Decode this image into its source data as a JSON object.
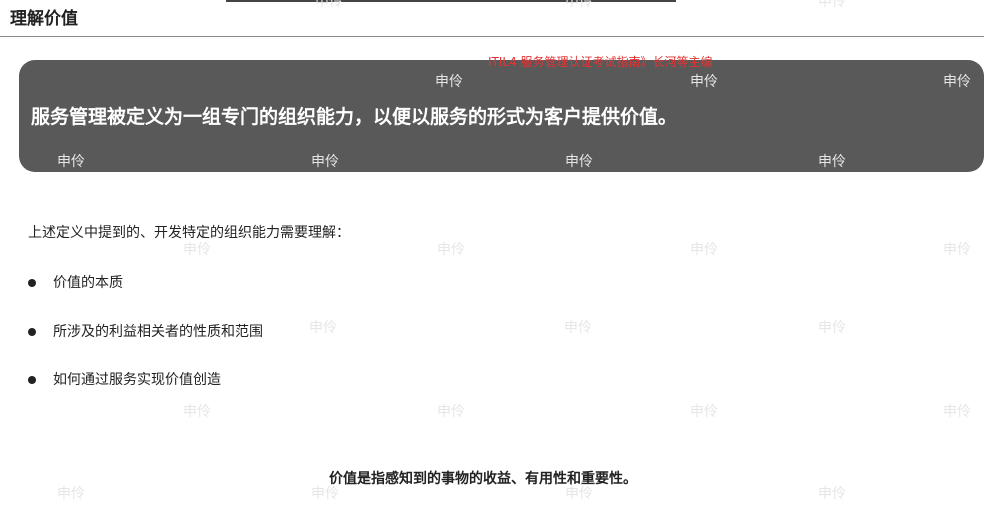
{
  "header": {
    "title": "理解价值"
  },
  "source_note": "ITIL4 服务管理认证考试指南》长河等主编",
  "definition": {
    "text": "服务管理被定义为一组专门的组织能力，以便以服务的形式为客户提供价值。"
  },
  "intro": "上述定义中提到的、开发特定的组织能力需要理解：",
  "bullets": [
    {
      "text": "价值的本质"
    },
    {
      "text": "所涉及的利益相关者的性质和范围"
    },
    {
      "text": "如何通过服务实现价值创造"
    }
  ],
  "closing": "价值是指感知到的事物的收益、有用性和重要性。",
  "watermark": {
    "text": "申伶"
  },
  "colors": {
    "definition_background": "#595959",
    "source_note": "#e23434",
    "watermark": "#e6e6e6"
  }
}
